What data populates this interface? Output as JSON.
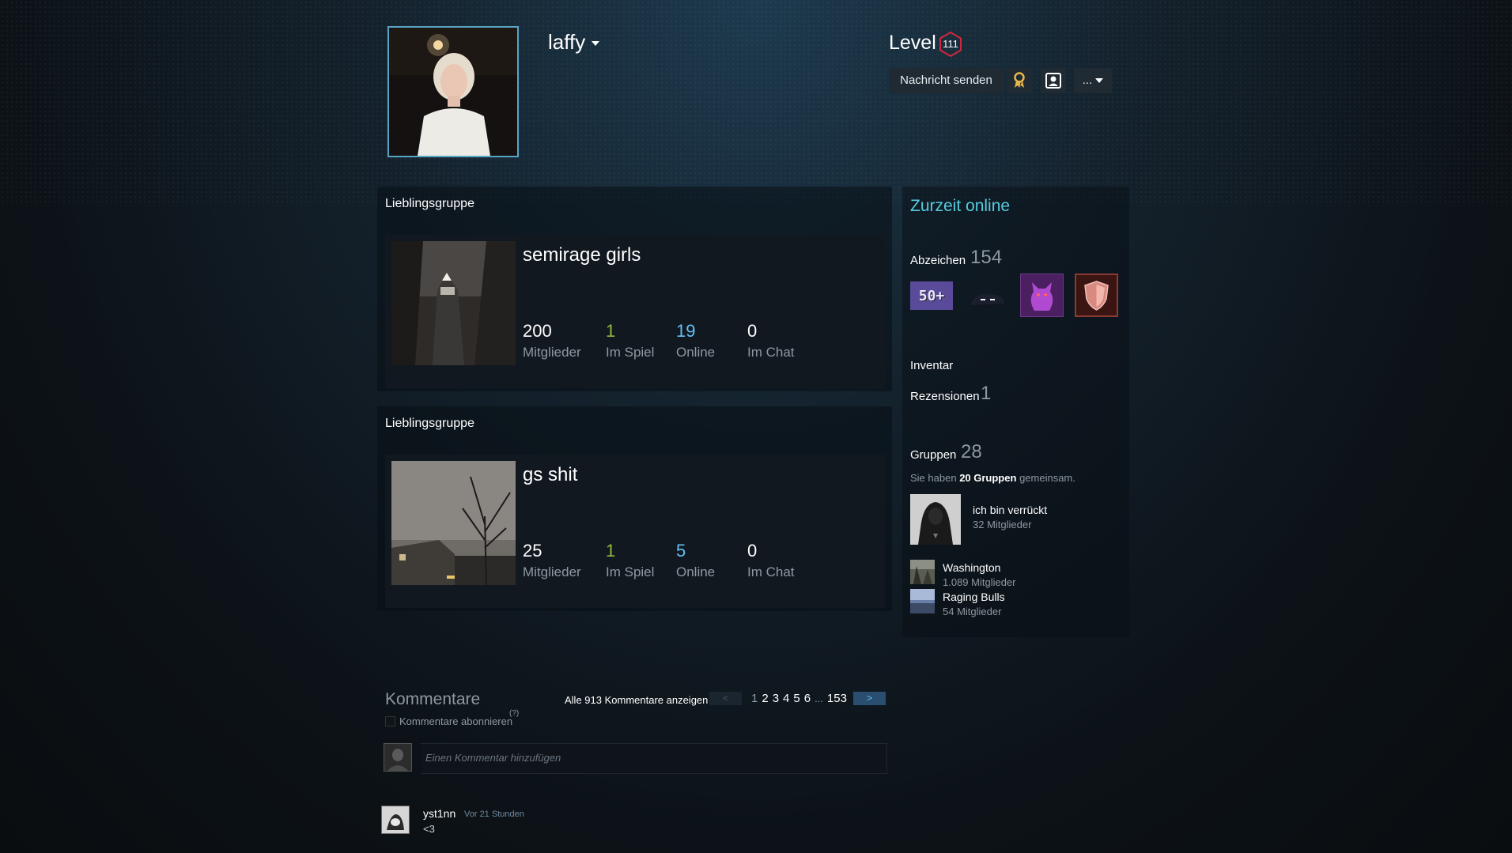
{
  "profile": {
    "username": "laffy",
    "level_label": "Level",
    "level": "111",
    "buttons": {
      "send_message": "Nachricht senden",
      "more": "..."
    }
  },
  "favorite_groups": [
    {
      "section_title": "Lieblingsgruppe",
      "name": "semirage girls",
      "stats": [
        {
          "value": "200",
          "label": "Mitglieder",
          "color": "#ffffff"
        },
        {
          "value": "1",
          "label": "Im Spiel",
          "color": "#90ba3c"
        },
        {
          "value": "19",
          "label": "Online",
          "color": "#66c0f4"
        },
        {
          "value": "0",
          "label": "Im Chat",
          "color": "#ffffff"
        }
      ]
    },
    {
      "section_title": "Lieblingsgruppe",
      "name": "gs shit",
      "stats": [
        {
          "value": "25",
          "label": "Mitglieder",
          "color": "#ffffff"
        },
        {
          "value": "1",
          "label": "Im Spiel",
          "color": "#90ba3c"
        },
        {
          "value": "5",
          "label": "Online",
          "color": "#66c0f4"
        },
        {
          "value": "0",
          "label": "Im Chat",
          "color": "#ffffff"
        }
      ]
    }
  ],
  "sidebar": {
    "online_status": "Zurzeit online",
    "badges": {
      "label": "Abzeichen",
      "count": "154",
      "first_badge_text": "50+"
    },
    "inventory": {
      "label": "Inventar"
    },
    "reviews": {
      "label": "Rezensionen",
      "count": "1"
    },
    "groups": {
      "label": "Gruppen",
      "count": "28",
      "common_prefix": "Sie haben",
      "common_bold": "20 Gruppen",
      "common_suffix": "gemeinsam.",
      "list": [
        {
          "name": "ich bin verrückt",
          "members": "32 Mitglieder"
        },
        {
          "name": "Washington",
          "members": "1.089 Mitglieder"
        },
        {
          "name": "Raging Bulls",
          "members": "54 Mitglieder"
        }
      ]
    }
  },
  "comments": {
    "title": "Kommentare",
    "subscribe": "Kommentare abonnieren",
    "help": "(?)",
    "view_all": "Alle 913 Kommentare anzeigen",
    "pager": {
      "prev": "<",
      "next": ">",
      "pages": [
        "1",
        "2",
        "3",
        "4",
        "5",
        "6"
      ],
      "ellipsis": "...",
      "last": "153"
    },
    "placeholder": "Einen Kommentar hinzufügen",
    "items": [
      {
        "author": "yst1nn",
        "time": "Vor 21 Stunden",
        "text": "<3"
      }
    ]
  },
  "colors": {
    "accent": "#57cbde",
    "in_game": "#90ba3c",
    "online": "#66c0f4",
    "level_ring": "#d0283a"
  }
}
